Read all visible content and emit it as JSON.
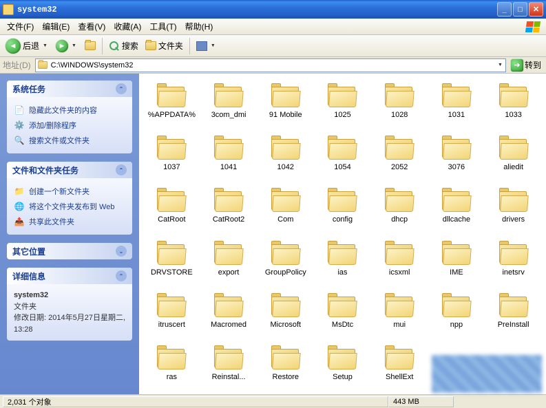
{
  "title": "system32",
  "menus": [
    "文件(F)",
    "编辑(E)",
    "查看(V)",
    "收藏(A)",
    "工具(T)",
    "帮助(H)"
  ],
  "toolbar": {
    "back": "后退",
    "search": "搜索",
    "folders": "文件夹"
  },
  "addressbar": {
    "label": "地址(D)",
    "path": "C:\\WINDOWS\\system32",
    "go": "转到"
  },
  "sidebar": {
    "panel1": {
      "title": "系统任务",
      "tasks": [
        "隐藏此文件夹的内容",
        "添加/删除程序",
        "搜索文件或文件夹"
      ]
    },
    "panel2": {
      "title": "文件和文件夹任务",
      "tasks": [
        "创建一个新文件夹",
        "将这个文件夹发布到 Web",
        "共享此文件夹"
      ]
    },
    "panel3": {
      "title": "其它位置"
    },
    "panel4": {
      "title": "详细信息",
      "name": "system32",
      "type": "文件夹",
      "modlabel": "修改日期: ",
      "moddate": "2014年5月27日星期二, 13:28"
    }
  },
  "folders": [
    "%APPDATA%",
    "3com_dmi",
    "91 Mobile",
    "1025",
    "1028",
    "1031",
    "1033",
    "1037",
    "1041",
    "1042",
    "1054",
    "2052",
    "3076",
    "aliedit",
    "CatRoot",
    "CatRoot2",
    "Com",
    "config",
    "dhcp",
    "dllcache",
    "drivers",
    "DRVSTORE",
    "export",
    "GroupPolicy",
    "ias",
    "icsxml",
    "IME",
    "inetsrv",
    "itruscert",
    "Macromed",
    "Microsoft",
    "MsDtc",
    "mui",
    "npp",
    "PreInstall",
    "ras",
    "Reinstal...",
    "Restore",
    "Setup",
    "ShellExt"
  ],
  "status": {
    "objects": "2,031 个对象",
    "size": "443 MB"
  }
}
